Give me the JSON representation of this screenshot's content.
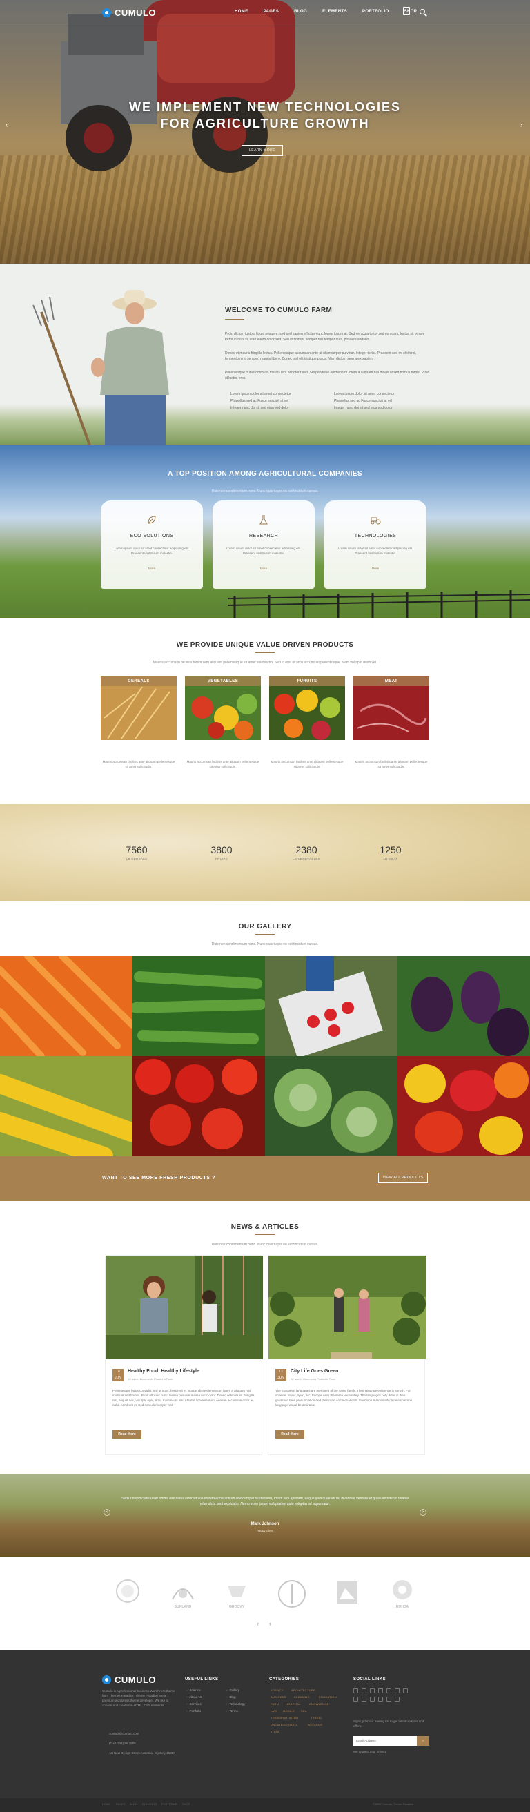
{
  "nav": {
    "logo": "CUMULO",
    "menu": [
      "HOME",
      "PAGES",
      "BLOG",
      "ELEMENTS",
      "PORTFOLIO",
      "SHOP"
    ]
  },
  "hero": {
    "title_line1": "WE IMPLEMENT NEW TECHNOLOGIES",
    "title_line2": "FOR AGRICULTURE GROWTH",
    "button": "LEARN MORE",
    "prev": "‹",
    "next": "›"
  },
  "welcome": {
    "title": "WELCOME TO CUMULO FARM",
    "p1": "Proin dictum justo a ligula posuere, sed sed sapien efficitur nunc lorem ipsum at. Sed vehicula tortor sed ex quam, luctus sit ornare tortor cursus sit ante lorem dolor sed. Sed in finibus, semper nisl tempor quis, posuere sodales.",
    "p2": "Donec et mauris fringilla lectus. Pellentesque accumsan ante at ullamcorper pulvinar. Integer tortor. Praesent sed mi eleifend, fermentum mi semper, mauris libero. Donec nisl elit tristique purus. Nam dictum sem a ex sapien.",
    "p3": "Pellentesque purus convallis mauris leo, hendrerit sed. Suspendisse elementum lorem a aliquam nisi mollis at sed finibus turpis. Proin id luctus eros.",
    "bullets_left": [
      "Lorem ipsum dolor sit amet consectetur",
      "Phasellus sed ac Fusce suscipit at vel",
      "Integer nunc dui sit sed eiusmod dolor"
    ],
    "bullets_right": [
      "Lorem ipsum dolor sit amet consectetur",
      "Phasellus sed ac Fusce suscipit at vel",
      "Integer nunc dui sit sed eiusmod dolor"
    ]
  },
  "top_position": {
    "title": "A TOP POSITION AMONG AGRICULTURAL COMPANIES",
    "subtitle": "Duis non condimentum nunc. Nunc quis turpis eu est tincidunt cursus.",
    "cards": [
      {
        "title": "ECO SOLUTIONS",
        "desc": "Lorem ipsum dolor sit amet consectetur adipiscing elit. Praesent vestibulum molestie.",
        "more": "More",
        "icon": "leaf-icon"
      },
      {
        "title": "RESEARCH",
        "desc": "Lorem ipsum dolor sit amet consectetur adipiscing elit. Praesent vestibulum molestie.",
        "more": "More",
        "icon": "flask-icon"
      },
      {
        "title": "TECHNOLOGIES",
        "desc": "Lorem ipsum dolor sit amet consectetur adipiscing elit. Praesent vestibulum molestie.",
        "more": "More",
        "icon": "tractor-icon"
      }
    ]
  },
  "products": {
    "title": "WE PROVIDE UNIQUE VALUE DRIVEN PRODUCTS",
    "subtitle": "Mauris accumsan facilisis lorem sem aliquam pellentesque sit amet sollicitudin. Sed id erat ut arcu accumsan pellentesque. Nam volutpat diam vel.",
    "items": [
      {
        "label": "CEREALS",
        "desc": "Mauris accumsan facilisis ante aliquam pellentesque sit amet sollicitudin."
      },
      {
        "label": "VEGETABLES",
        "desc": "Mauris accumsan facilisis ante aliquam pellentesque sit amet sollicitudin."
      },
      {
        "label": "FURUITS",
        "desc": "Mauris accumsan facilisis ante aliquam pellentesque sit amet sollicitudin."
      },
      {
        "label": "MEAT",
        "desc": "Mauris accumsan facilisis ante aliquam pellentesque sit amet sollicitudin."
      }
    ]
  },
  "stats": [
    {
      "num": "7560",
      "label": "LB CEREALS"
    },
    {
      "num": "3800",
      "label": "FRUITS"
    },
    {
      "num": "2380",
      "label": "LB VEGETABLES"
    },
    {
      "num": "1250",
      "label": "LB MEAT"
    }
  ],
  "gallery": {
    "title": "OUR GALLERY",
    "subtitle": "Duis non condimentum nunc. Nunc quis turpis eu est tincidunt cursus.",
    "images": [
      "carrots",
      "cucumbers",
      "strawberries",
      "eggplants",
      "corn",
      "tomatoes",
      "cabbage",
      "peppers"
    ]
  },
  "cta": {
    "text": "WANT TO SEE MORE FRESH PRODUCTS ?",
    "button": "VIEW ALL PRODUCTS"
  },
  "news": {
    "title": "NEWS & ARTICLES",
    "subtitle": "Duis non condimentum nunc. Nunc quis turpis eu est tincidunt cursus.",
    "articles": [
      {
        "title": "Healthy Food, Healthy Lifestyle",
        "day": "18",
        "month": "JUN",
        "meta": "By admin   Comments   Posted in Farm",
        "text": "Pellentesque lacus convallis, nisi ut nunc, hendrerit et. Suspendisse elementum lorem a aliquam nisi mollis at sed finibus. Proin ultricies nunc, lacinia posuere massa nunc dolor. Donec vehicula in. Fringilla nisi, aliquet nec, volutpat eget, arcu. In vehicula nisi, efficitur condimentum. Aenean accumsan dolor ac nulla, hendrerit et. Sed non ullamcorper nisl.",
        "button": "Read More"
      },
      {
        "title": "City Life Goes Green",
        "day": "12",
        "month": "JUN",
        "meta": "By admin   Comments   Posted in Farm",
        "text": "The European languages are members of the same family. Their separate existence is a myth. For science, music, sport, etc, Europe uses the same vocabulary. The languages only differ in their grammar, their pronunciation and their most common words. Everyone realizes why a new common language would be desirable.",
        "button": "Read More"
      }
    ]
  },
  "testimonial": {
    "quote": "Sed ut perspiciatis unde omnis iste natus error sit voluptatem accusantium doloremque laudantium, totam rem aperiam, eaque ipsa quae ab illo inventore veritatis et quasi architecto beatae vitae dicta sunt explicabo. Nemo enim ipsam voluptatem quia voluptas sit aspernatur.",
    "author": "Mark Johnson",
    "role": "Happy client"
  },
  "partners": [
    "",
    "SUNLAND",
    "GROOVY",
    "",
    "",
    "ROHDA"
  ],
  "footer": {
    "logo": "CUMULO",
    "about": "Cumulo is a professional business WordPress theme from Themes Paradise. Theme Paradise are a premium wordpress theme developer. We like to choose and create the HTML, CSS elements.",
    "email": "contact@cumulo.com",
    "phone": "P: +1(234) 56 7890",
    "address": "Art New Design Street Australia - Sydney 15800",
    "useful_title": "USEFUL LINKS",
    "links_col1": [
      "Science",
      "About Us",
      "Services",
      "Portfolio"
    ],
    "links_col2": [
      "Gallery",
      "Blog",
      "Technology",
      "Terms"
    ],
    "categories_title": "CATEGORIES",
    "tags": [
      "AGENCY",
      "ARCHITECTURE",
      "BUSINESS",
      "CLEANING",
      "EDUCATION",
      "FARM",
      "HOSPITAL",
      "KNOWLEDGE",
      "LAW",
      "MOBILE",
      "SEA",
      "TRANSPORTATION",
      "TRAVEL",
      "UNCATEGORIZED",
      "WEDDING",
      "YOGA"
    ],
    "social_title": "SOCIAL LINKS",
    "newsletter_text": "Sign up for our mailing list to get latest updates and offers.",
    "email_placeholder": "Email Address",
    "send": "›",
    "privacy": "We respect your privacy",
    "bottom_links": [
      "HOME",
      "PAGES",
      "BLOG",
      "ELEMENTS",
      "PORTFOLIO",
      "SHOP"
    ],
    "copyright": "© 2017 Cumulo. Theme Paradise."
  },
  "colors": {
    "accent": "#a88150",
    "brand_blue": "#1d8ce0",
    "footer_bg": "#333333"
  }
}
